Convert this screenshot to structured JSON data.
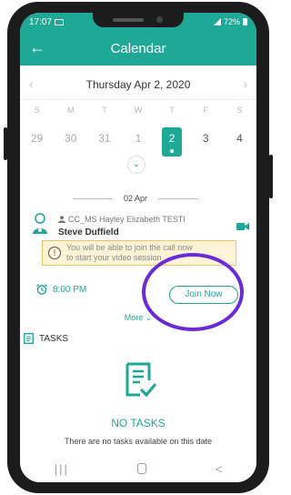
{
  "status_bar": {
    "time": "17:07",
    "battery": "72%"
  },
  "header": {
    "title": "Calendar"
  },
  "calendar": {
    "date_title": "Thursday Apr 2, 2020",
    "weekdays": [
      "S",
      "M",
      "T",
      "W",
      "T",
      "F",
      "S"
    ],
    "days": [
      "29",
      "30",
      "31",
      "1",
      "2",
      "3",
      "4"
    ],
    "selected_day": "2"
  },
  "date_divider": "02 Apr",
  "appointment": {
    "patient": "CC_MS Hayley Elizabeth TESTI",
    "doctor": "Steve Duffield",
    "warning_line1": "You will be able to join the call now",
    "warning_line2": "to start your video session",
    "time": "8:00 PM",
    "join_label": "Join Now",
    "more_label": "More ⌄"
  },
  "tasks": {
    "title": "TASKS",
    "empty_title": "NO TASKS",
    "empty_subtitle": "There are no tasks available on this date"
  },
  "nav_bar": {
    "recent": "|||",
    "back": "<"
  },
  "colors": {
    "primary": "#1ea896",
    "highlight": "#6a2bd6",
    "warning_bg": "#fdf3d6"
  }
}
